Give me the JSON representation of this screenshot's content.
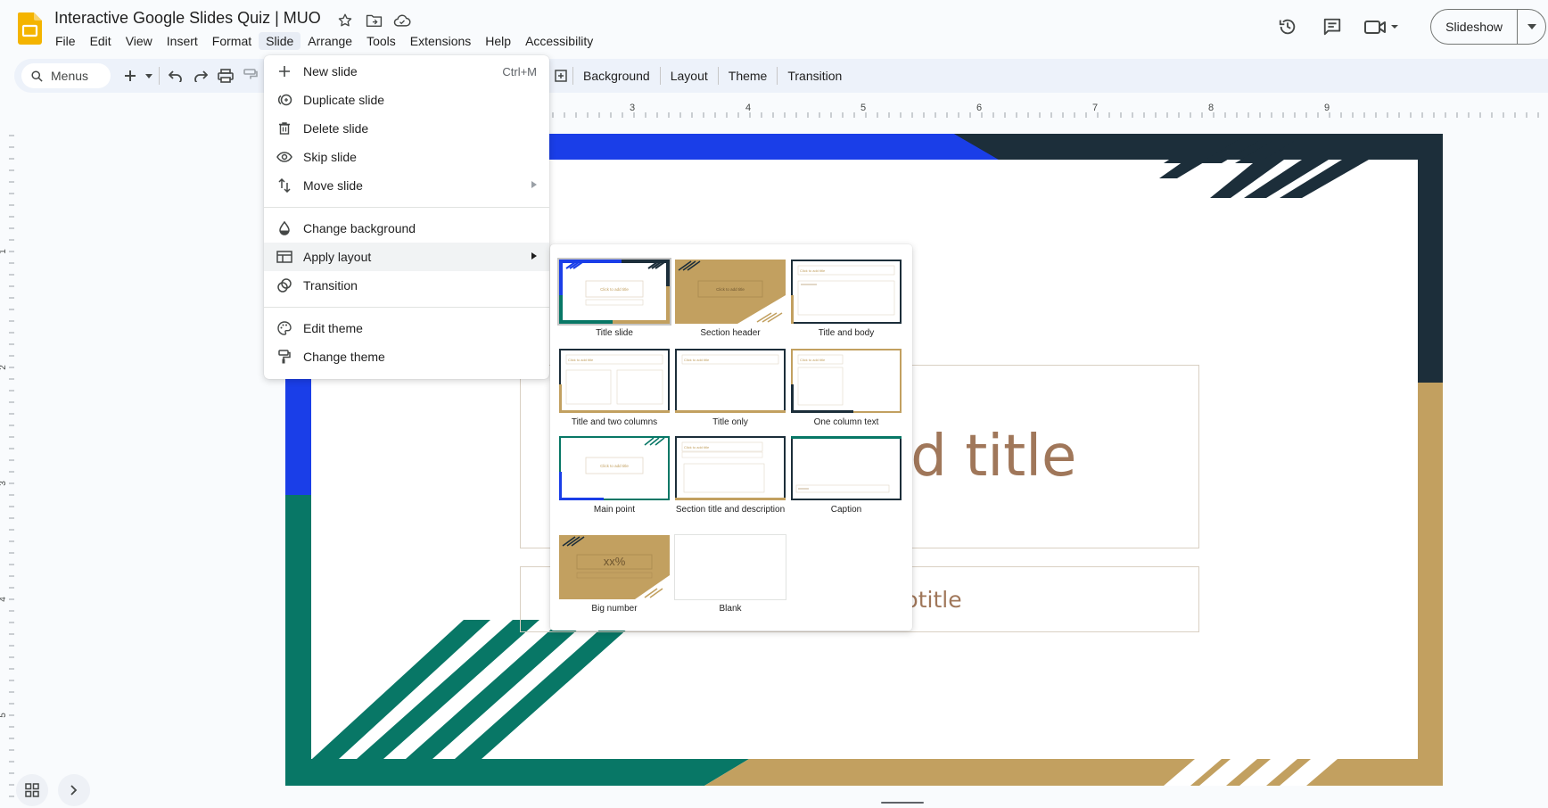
{
  "header": {
    "title": "Interactive Google Slides Quiz | MUO",
    "slideshow_label": "Slideshow"
  },
  "menubar": {
    "items": [
      "File",
      "Edit",
      "View",
      "Insert",
      "Format",
      "Slide",
      "Arrange",
      "Tools",
      "Extensions",
      "Help",
      "Accessibility"
    ],
    "active": "Slide"
  },
  "toolbar": {
    "search_label": "Menus",
    "background": "Background",
    "layout": "Layout",
    "theme": "Theme",
    "transition": "Transition"
  },
  "ruler": {
    "h_labels": [
      "3",
      "4",
      "5",
      "6",
      "7",
      "8",
      "9"
    ],
    "v_labels": [
      "1",
      "2",
      "3",
      "4",
      "5"
    ]
  },
  "slide": {
    "title_placeholder": "Click to add title",
    "subtitle_placeholder": "Click to add subtitle",
    "visible_title": "dd title",
    "visible_subtitle": "otitle"
  },
  "slide_menu": {
    "new_slide": "New slide",
    "new_slide_shortcut": "Ctrl+M",
    "duplicate_slide": "Duplicate slide",
    "delete_slide": "Delete slide",
    "skip_slide": "Skip slide",
    "move_slide": "Move slide",
    "change_background": "Change background",
    "apply_layout": "Apply layout",
    "transition": "Transition",
    "edit_theme": "Edit theme",
    "change_theme": "Change theme"
  },
  "layouts": [
    {
      "label": "Title slide"
    },
    {
      "label": "Section header"
    },
    {
      "label": "Title and body"
    },
    {
      "label": "Title and two columns"
    },
    {
      "label": "Title only"
    },
    {
      "label": "One column text"
    },
    {
      "label": "Main point"
    },
    {
      "label": "Section title and description"
    },
    {
      "label": "Caption"
    },
    {
      "label": "Big number",
      "thumb_text": "xx%"
    },
    {
      "label": "Blank"
    }
  ],
  "thumb_text": {
    "click_to_add_title": "Click to add title"
  },
  "colors": {
    "blue": "#1a3ee8",
    "green": "#087766",
    "navy": "#1c2e3a",
    "gold": "#c2a060",
    "accent_text": "#a0775a",
    "logo_yellow": "#f4b400"
  }
}
